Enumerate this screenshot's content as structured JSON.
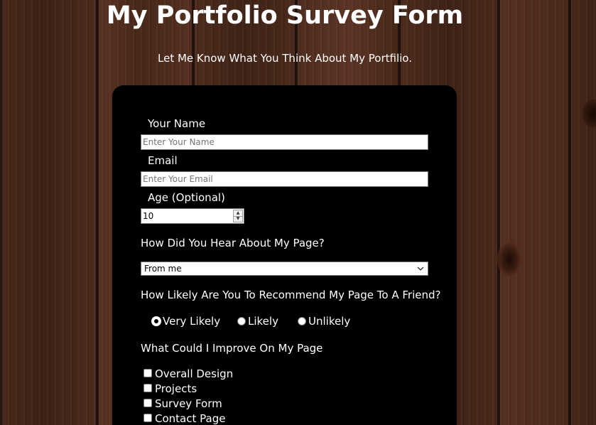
{
  "header": {
    "title": "My Portfolio Survey Form",
    "subtitle": "Let Me Know What You Think About My Portfilio."
  },
  "form": {
    "name": {
      "label": "Your Name",
      "placeholder": "Enter Your Name",
      "value": ""
    },
    "email": {
      "label": "Email",
      "placeholder": "Enter Your Email",
      "value": ""
    },
    "age": {
      "label": "Age (Optional)",
      "value": "10"
    },
    "referral": {
      "question": "How Did You Hear About My Page?",
      "selected": "From me"
    },
    "recommend": {
      "question": "How Likely Are You To Recommend My Page To A Friend?",
      "options": [
        "Very Likely",
        "Likely",
        "Unlikely"
      ],
      "selected": "Very Likely"
    },
    "improve": {
      "question": "What Could I Improve On My Page",
      "options": [
        "Overall Design",
        "Projects",
        "Survey Form",
        "Contact Page"
      ],
      "checked": []
    }
  },
  "colors": {
    "card_background": "#000000",
    "text": "#ffffff",
    "background_wood": "#4a2a1c"
  },
  "icons": {
    "select_arrow": "chevron-down-icon",
    "spinner_up": "spin-up-icon",
    "spinner_down": "spin-down-icon"
  }
}
